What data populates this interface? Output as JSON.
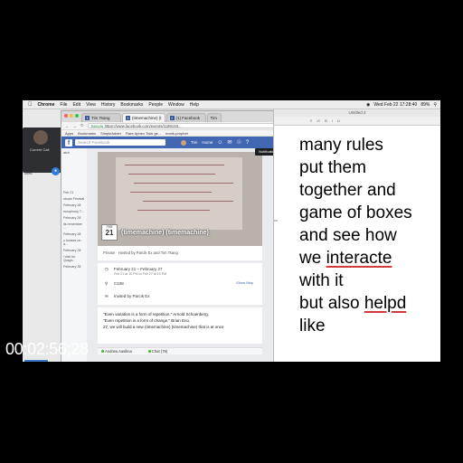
{
  "menubar": {
    "apple": "",
    "app": "Chrome",
    "items": [
      "File",
      "Edit",
      "View",
      "History",
      "Bookmarks",
      "People",
      "Window",
      "Help"
    ],
    "status": "Wed Feb 22  17:28:40",
    "battery": "89%"
  },
  "videocall": {
    "label": "Current Call",
    "side_text": "ches"
  },
  "chrome": {
    "tabs": [
      {
        "label": "Tim Tsang"
      },
      {
        "label": "(timemachine) (t"
      },
      {
        "label": "(1) Facebook"
      },
      {
        "label": "Tim"
      }
    ],
    "url_secure": "Secure",
    "url": "https://www.facebook.com/events/1189193...",
    "bookmarks": [
      "Apps",
      "Bookmarks",
      "SimpleAdder",
      "Rare Aphex Twin ge...",
      "monk-prophet"
    ]
  },
  "facebook": {
    "search_placeholder": "Search Facebook",
    "user": "Tim",
    "home": "Home",
    "notifications": "Notifications",
    "left_items": [
      "atch",
      "Feb 21",
      "ukuan Festival",
      "February 28",
      "europhony T...",
      "February 28",
      "lis remember ...",
      "February 28",
      "y houses on a...",
      "February 28",
      "l visit for Quays...",
      "February 28"
    ],
    "date_month": "FEB",
    "date_day": "21",
    "event_title": "(timemachine) (timemachine)",
    "host_line": "Private · Hosted by Parcik Ex and Tim Tsang",
    "date_range": "February 21 – February 27",
    "date_sub": "Feb 21 at 10 PM to Feb 27 at 10 PM",
    "location": "C108",
    "show_map": "Show Map",
    "invited": "Invited by Parcik Ex",
    "desc_lines": [
      "\"Even variation is a form of repetition.\" Arnold Schoenberg.",
      "\"Even repetition is a form of change.\" Brian Eno.",
      "",
      "27, we will build a new (timemachine) (timemachine) that is at once"
    ],
    "chat_person": "Andrew Aasilina",
    "chat_label": "Chat (79)"
  },
  "notes": {
    "title": "Untitled 2",
    "lines": [
      {
        "parts": [
          {
            "t": "many rules",
            "sp": false
          }
        ]
      },
      {
        "parts": [
          {
            "t": "put them",
            "sp": false
          }
        ]
      },
      {
        "parts": [
          {
            "t": "together and",
            "sp": false
          }
        ]
      },
      {
        "parts": [
          {
            "t": "game of boxes",
            "sp": false
          }
        ]
      },
      {
        "parts": [
          {
            "t": "and see how",
            "sp": false
          }
        ]
      },
      {
        "parts": [
          {
            "t": "we ",
            "sp": false
          },
          {
            "t": "interacte",
            "sp": true
          }
        ]
      },
      {
        "parts": [
          {
            "t": "with it",
            "sp": false
          }
        ]
      },
      {
        "parts": [
          {
            "t": "but also ",
            "sp": false
          },
          {
            "t": "helpd",
            "sp": true
          }
        ]
      },
      {
        "parts": [
          {
            "t": "like",
            "sp": false
          }
        ]
      }
    ],
    "side_hint": "ce"
  },
  "overlay": {
    "timecode": "00:02:56;28"
  }
}
